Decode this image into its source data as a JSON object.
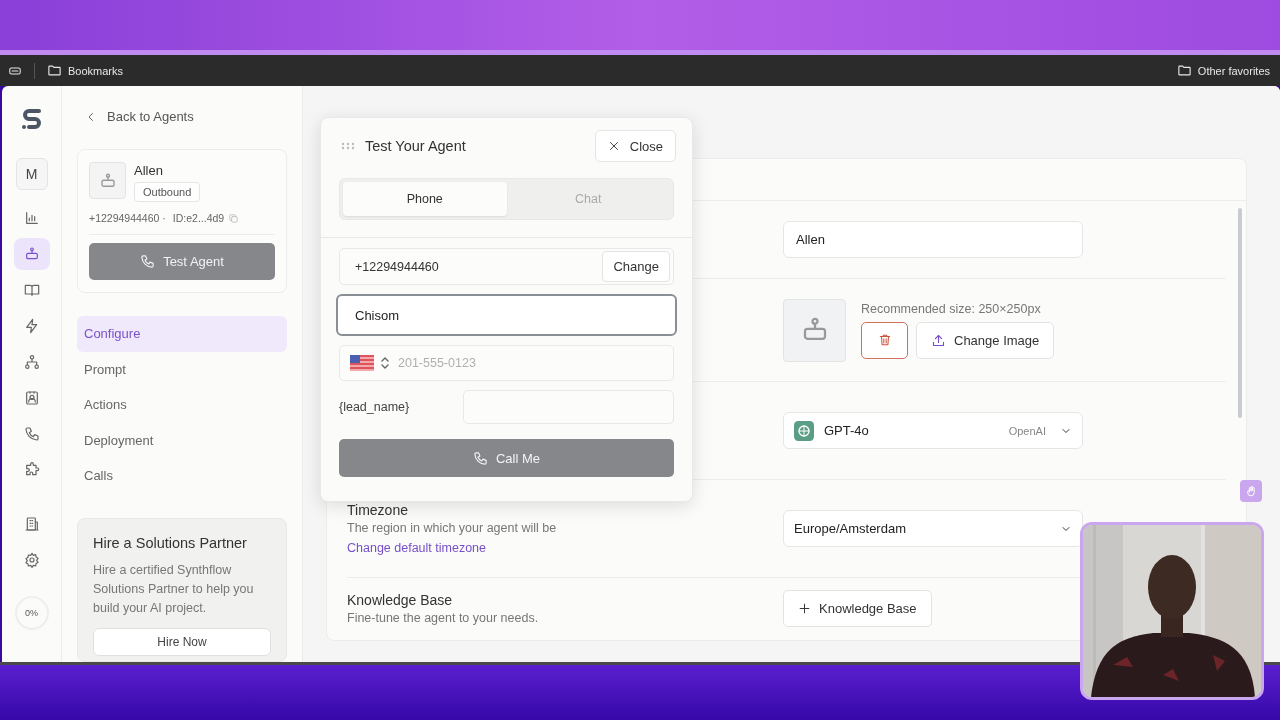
{
  "browser": {
    "bookmarks": "Bookmarks",
    "other_favorites": "Other favorites"
  },
  "rail": {
    "workspace": "M",
    "items": [
      {
        "kind": "chart",
        "selected": false
      },
      {
        "kind": "bot",
        "selected": true
      },
      {
        "kind": "book",
        "selected": false
      },
      {
        "kind": "bolt",
        "selected": false
      },
      {
        "kind": "tree",
        "selected": false
      },
      {
        "kind": "contact",
        "selected": false
      },
      {
        "kind": "phone",
        "selected": false
      },
      {
        "kind": "puzzle",
        "selected": false
      }
    ],
    "bottom_items": [
      {
        "kind": "building",
        "selected": false
      },
      {
        "kind": "gear",
        "selected": false
      }
    ],
    "progress": "0%"
  },
  "agent_panel": {
    "back": "Back to Agents",
    "name": "Allen",
    "tag": "Outbound",
    "phone": "+12294944460 ·",
    "id": "ID:e2...4d9",
    "test_button": "Test Agent",
    "nav": [
      {
        "label": "Configure",
        "selected": true
      },
      {
        "label": "Prompt",
        "selected": false
      },
      {
        "label": "Actions",
        "selected": false
      },
      {
        "label": "Deployment",
        "selected": false
      },
      {
        "label": "Calls",
        "selected": false
      }
    ],
    "promo": {
      "title": "Hire a Solutions Partner",
      "text": "Hire a certified Synthflow Solutions Partner to help you build your AI project.",
      "button": "Hire Now"
    }
  },
  "modal": {
    "title": "Test Your Agent",
    "close": "Close",
    "tabs": [
      {
        "label": "Phone",
        "selected": true
      },
      {
        "label": "Chat",
        "selected": false
      }
    ],
    "caller_number": "+12294944460",
    "change": "Change",
    "name_value": "Chisom",
    "phone_placeholder": "201-555-0123",
    "variable": "{lead_name}",
    "call_button": "Call Me"
  },
  "settings": {
    "name_value": "Allen",
    "avatar_hint": "Recommended size: 250×250px",
    "change_image": "Change Image",
    "model": "GPT-4o",
    "provider": "OpenAI",
    "timezone": {
      "title": "Timezone",
      "description": "The region in which your agent will be",
      "link": "Change default timezone",
      "value": "Europe/Amsterdam"
    },
    "knowledge": {
      "title": "Knowledge Base",
      "description": "Fine-tune the agent to your needs.",
      "button": "Knowledge Base"
    }
  }
}
